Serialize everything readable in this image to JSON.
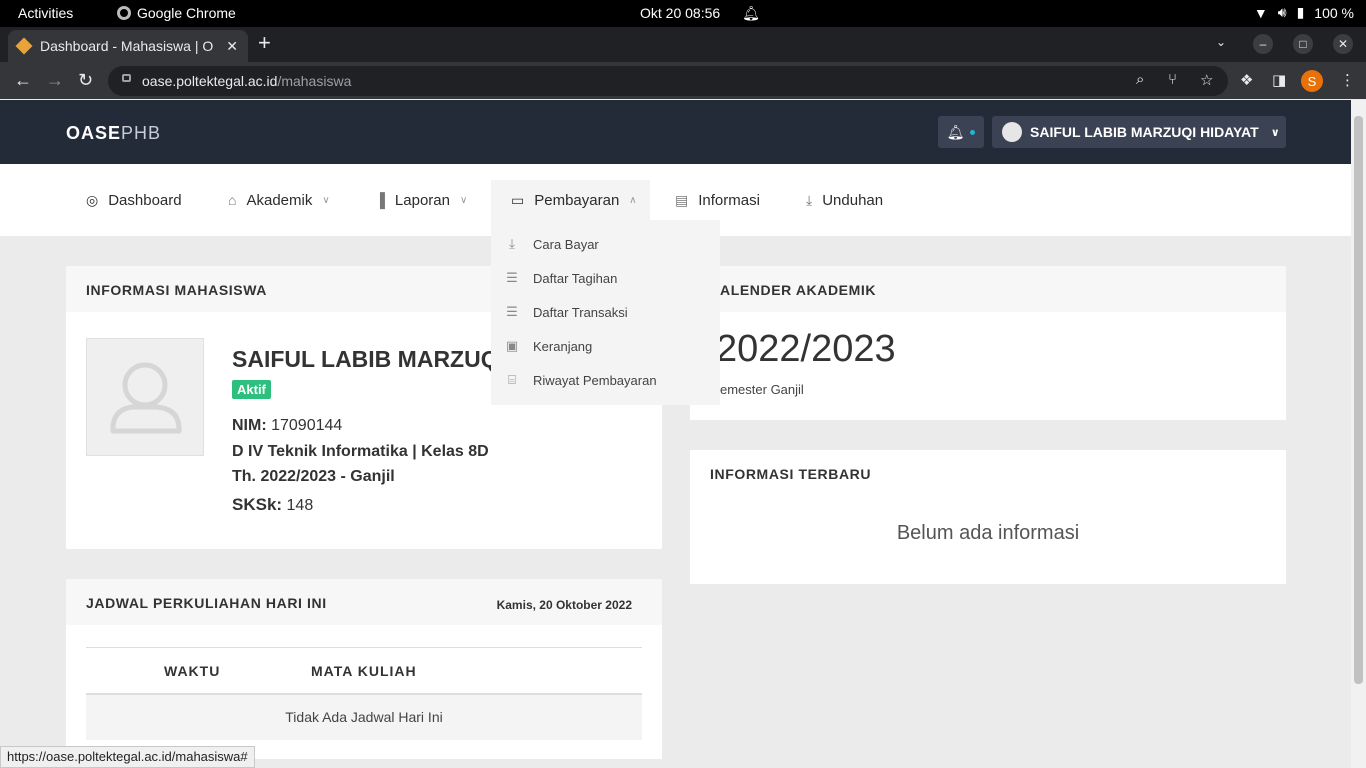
{
  "system": {
    "activities": "Activities",
    "app_name": "Google Chrome",
    "datetime": "Okt 20  08:56",
    "battery": "100 %"
  },
  "browser": {
    "tab_title": "Dashboard - Mahasiswa | O",
    "url_domain": "oase.poltektegal.ac.id",
    "url_path": "/mahasiswa",
    "profile_initial": "S",
    "status_url": "https://oase.poltektegal.ac.id/mahasiswa#"
  },
  "header": {
    "brand_bold": "OASE",
    "brand_light": "PHB",
    "user_name": "SAIFUL LABIB MARZUQI HIDAYAT"
  },
  "nav": {
    "items": [
      {
        "label": "Dashboard",
        "icon": "compass-icon"
      },
      {
        "label": "Akademik",
        "icon": "graduation-cap-icon"
      },
      {
        "label": "Laporan",
        "icon": "bar-chart-icon"
      },
      {
        "label": "Pembayaran",
        "icon": "credit-card-icon"
      },
      {
        "label": "Informasi",
        "icon": "newspaper-icon"
      },
      {
        "label": "Unduhan",
        "icon": "download-icon"
      }
    ],
    "dropdown": [
      {
        "label": "Cara Bayar",
        "icon": "download-icon"
      },
      {
        "label": "Daftar Tagihan",
        "icon": "list-icon"
      },
      {
        "label": "Daftar Transaksi",
        "icon": "list-icon"
      },
      {
        "label": "Keranjang",
        "icon": "shopping-bag-icon"
      },
      {
        "label": "Riwayat Pembayaran",
        "icon": "file-icon"
      }
    ]
  },
  "student": {
    "card_title": "INFORMASI MAHASISWA",
    "name": "SAIFUL LABIB MARZUQ",
    "status": "Aktif",
    "nim_label": "NIM:",
    "nim": "17090144",
    "program": "D IV Teknik Informatika | Kelas 8D",
    "period": "Th. 2022/2023 - Ganjil",
    "sks_label": "SKSk:",
    "sks": "148"
  },
  "calendar": {
    "card_title": "ALENDER AKADEMIK",
    "year": "2022/2023",
    "semester": "emester Ganjil"
  },
  "news": {
    "card_title": "INFORMASI TERBARU",
    "empty": "Belum ada informasi"
  },
  "schedule": {
    "card_title": "JADWAL PERKULIAHAN HARI INI",
    "date": "Kamis, 20 Oktober 2022",
    "col_time": "WAKTU",
    "col_course": "MATA KULIAH",
    "empty": "Tidak Ada Jadwal Hari Ini"
  }
}
